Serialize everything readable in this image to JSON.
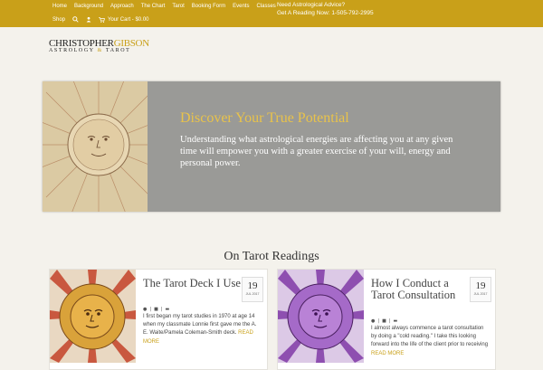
{
  "nav": {
    "row1": [
      "Home",
      "Background",
      "Approach",
      "The Chart",
      "Tarot",
      "Booking Form",
      "Events",
      "Classes"
    ],
    "shop": "Shop",
    "cart": "Your Cart - $0.00"
  },
  "advice": {
    "line1": "Need Astrological Advice?",
    "line2": "Get A Reading Now: 1-505-792-2995"
  },
  "logo": {
    "name_first": "CHRISTOPHER",
    "name_last": "GIBSON",
    "sub_left": "ASTROLOGY",
    "amp": "&",
    "sub_right": "TAROT"
  },
  "hero": {
    "title": "Discover Your True Potential",
    "text": "Understanding what astrological energies are affecting you at any given time will empower you with a greater exercise of your will, energy and personal power."
  },
  "section_title": "On Tarot Readings",
  "posts": [
    {
      "title": "The Tarot Deck I Use",
      "day": "19",
      "month": "JUL 2017",
      "excerpt": "I first began my tarot studies in 1970 at age 14 when my classmate Lonnie first gave me the A. E. Waite/Pamela Coleman-Smith deck.",
      "read_more": "READ MORE"
    },
    {
      "title": "How I Conduct a Tarot Consultation",
      "day": "19",
      "month": "JUL 2017",
      "excerpt": "I almost always commence a tarot consultation by doing a \"cold reading.\" I take this looking forward into the life of the client prior to receiving",
      "read_more": "READ MORE"
    }
  ],
  "colors": {
    "gold": "#c9a019",
    "hero_bg": "#9a9a97"
  }
}
